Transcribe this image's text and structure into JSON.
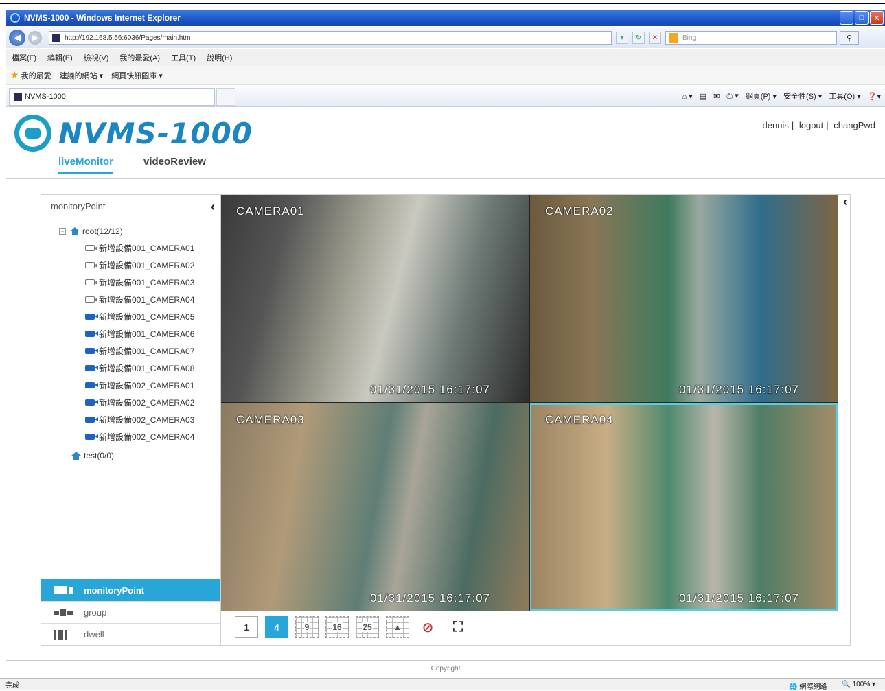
{
  "window": {
    "title": "NVMS-1000 - Windows Internet Explorer",
    "buttons": [
      "_",
      "□",
      "✕"
    ]
  },
  "address": {
    "url": "http://192.168.5.56:6036/Pages/main.htm",
    "search_placeholder": "Bing"
  },
  "menubar": [
    "檔案(F)",
    "編輯(E)",
    "檢視(V)",
    "我的最愛(A)",
    "工具(T)",
    "說明(H)"
  ],
  "favbar": {
    "favorites": "我的最愛",
    "suggested_sites": "建議的網站 ▾",
    "web_slice": "網頁快訊圖庫 ▾"
  },
  "tab": {
    "title": "NVMS-1000"
  },
  "cmdbar": [
    "網頁(P) ▾",
    "安全性(S) ▾",
    "工具(O) ▾",
    "❓▾"
  ],
  "app": {
    "logo": "NVMS-1000",
    "user_links": {
      "user": "dennis",
      "sep1": "|",
      "logout": "logout",
      "sep2": "|",
      "change_pwd": "changPwd"
    },
    "tabs": {
      "live": "liveMonitor",
      "review": "videoReview"
    }
  },
  "panel": {
    "title": "monitoryPoint",
    "root_label": "root(12/12)",
    "cameras": [
      {
        "label": "新增設備001_CAMERA01",
        "status": "off"
      },
      {
        "label": "新增設備001_CAMERA02",
        "status": "off"
      },
      {
        "label": "新增設備001_CAMERA03",
        "status": "off"
      },
      {
        "label": "新增設備001_CAMERA04",
        "status": "off"
      },
      {
        "label": "新增設備001_CAMERA05",
        "status": "on"
      },
      {
        "label": "新增設備001_CAMERA06",
        "status": "on"
      },
      {
        "label": "新增設備001_CAMERA07",
        "status": "on"
      },
      {
        "label": "新增設備001_CAMERA08",
        "status": "on"
      },
      {
        "label": "新增設備002_CAMERA01",
        "status": "on"
      },
      {
        "label": "新增設備002_CAMERA02",
        "status": "on"
      },
      {
        "label": "新增設備002_CAMERA03",
        "status": "on"
      },
      {
        "label": "新增設備002_CAMERA04",
        "status": "on"
      }
    ],
    "test_label": "test(0/0)",
    "bottom_menu": {
      "monitory_point": "monitoryPoint",
      "group": "group",
      "dwell": "dwell"
    }
  },
  "video": {
    "tiles": [
      {
        "camera": "CAMERA01",
        "timestamp": "01/31/2015 16:17:07"
      },
      {
        "camera": "CAMERA02",
        "timestamp": "01/31/2015 16:17:07"
      },
      {
        "camera": "CAMERA03",
        "timestamp": "01/31/2015 16:17:07"
      },
      {
        "camera": "CAMERA04",
        "timestamp": "01/31/2015 16:17:07"
      }
    ],
    "layout_buttons": {
      "one": "1",
      "four": "4",
      "nine": "9",
      "sixteen": "16",
      "twentyfive": "25"
    }
  },
  "footer": {
    "copyright": "Copyright"
  },
  "statusbar": {
    "left": "完成",
    "zone": "網際網路",
    "zoom": "100%"
  },
  "colors": {
    "accent": "#29a6d8",
    "logo": "#1b86c2",
    "ie_title": "#1c56c9"
  }
}
